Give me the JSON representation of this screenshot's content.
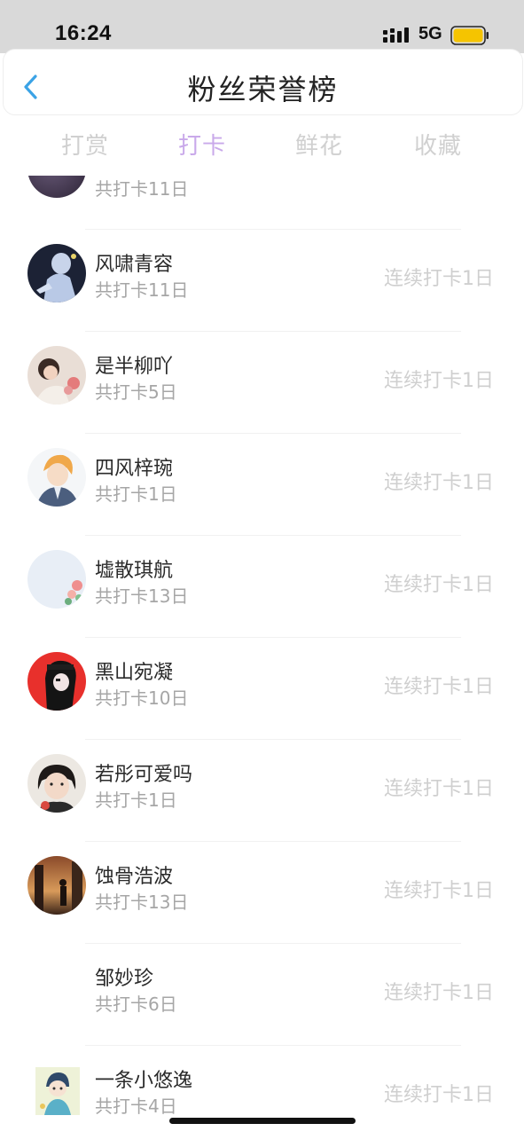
{
  "status_bar": {
    "time": "16:24",
    "network": "5G",
    "battery_color": "#f5c400"
  },
  "header": {
    "title": "粉丝荣誉榜"
  },
  "tabs": [
    {
      "label": "打赏",
      "active": false
    },
    {
      "label": "打卡",
      "active": true
    },
    {
      "label": "鲜花",
      "active": false
    },
    {
      "label": "收藏",
      "active": false
    }
  ],
  "colors": {
    "active_tab": "#c9a9ea",
    "inactive_tab": "#d0d0d0",
    "streak_text": "#cfcfcf",
    "back_icon": "#3ba3e6"
  },
  "partial_row": {
    "total": "共打卡11日"
  },
  "fans": [
    {
      "name": "风啸青容",
      "total": "共打卡11日",
      "streak": "连续打卡1日",
      "avatar": "anime-blue-figure"
    },
    {
      "name": "是半柳吖",
      "total": "共打卡5日",
      "streak": "连续打卡1日",
      "avatar": "girl-with-flowers"
    },
    {
      "name": "四风梓琬",
      "total": "共打卡1日",
      "streak": "连续打卡1日",
      "avatar": "anime-boy-orange-hair"
    },
    {
      "name": "墟散琪航",
      "total": "共打卡13日",
      "streak": "连续打卡1日",
      "avatar": "white-with-roses"
    },
    {
      "name": "黑山宛凝",
      "total": "共打卡10日",
      "streak": "连续打卡1日",
      "avatar": "anime-red-black"
    },
    {
      "name": "若彤可爱吗",
      "total": "共打卡1日",
      "streak": "连续打卡1日",
      "avatar": "child-photo"
    },
    {
      "name": "蚀骨浩波",
      "total": "共打卡13日",
      "streak": "连续打卡1日",
      "avatar": "silhouette-sunset"
    },
    {
      "name": "邹妙珍",
      "total": "共打卡6日",
      "streak": "连续打卡1日",
      "avatar": "none"
    },
    {
      "name": "一条小悠逸",
      "total": "共打卡4日",
      "streak": "连续打卡1日",
      "avatar": "anime-chibi"
    }
  ]
}
